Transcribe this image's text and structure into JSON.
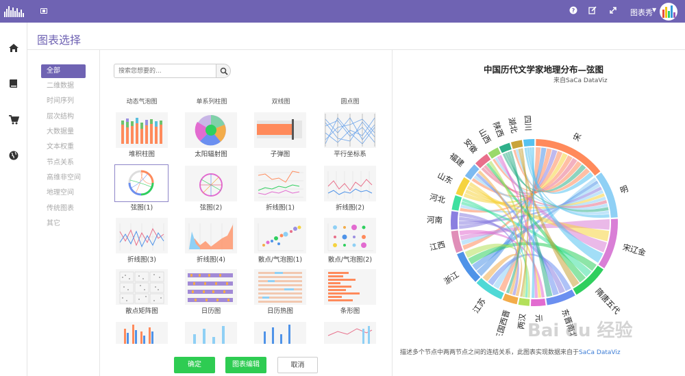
{
  "header": {
    "user_name": "图表秀",
    "icons": [
      "help-icon",
      "edit-icon",
      "fullscreen-icon"
    ]
  },
  "nav_icons": [
    "home-icon",
    "book-icon",
    "cart-icon",
    "globe-icon"
  ],
  "page_title": "图表选择",
  "categories": [
    "全部",
    "二维数据",
    "时间序列",
    "层次结构",
    "大数据量",
    "文本权重",
    "节点关系",
    "高维非空间",
    "地理空间",
    "传统图表",
    "其它"
  ],
  "search": {
    "placeholder": "搜索您想要的..."
  },
  "column_headers": [
    "动态气泡图",
    "单系列柱图",
    "双线图",
    "圆点图"
  ],
  "chart_cards": [
    "堆积柱图",
    "太阳辐射图",
    "子弹图",
    "平行坐标系",
    "弦图(1)",
    "弦图(2)",
    "折线图(1)",
    "折线图(2)",
    "折线图(3)",
    "折线图(4)",
    "散点/气泡图(1)",
    "散点/气泡图(2)",
    "散点矩阵图",
    "日历图",
    "日历热图",
    "条形图"
  ],
  "buttons": {
    "ok": "确定",
    "edit": "图表编辑",
    "cancel": "取消"
  },
  "preview": {
    "title": "中国历代文学家地理分布—弦图",
    "subtitle": "来自SaCa DataViz",
    "description_prefix": "描述多个节点中两两节点之间的连结关系，此图表实现数据来自于",
    "description_link": "SaCa DataViz",
    "watermark": "Bai du 经验"
  },
  "chart_data": {
    "type": "chord",
    "title": "中国历代文学家地理分布—弦图",
    "subtitle": "来自SaCa DataViz",
    "nodes": [
      {
        "name": "宋",
        "color": "#ff8a5b"
      },
      {
        "name": "明",
        "color": "#8fd0f5"
      },
      {
        "name": "宋辽金",
        "color": "#d97fd6"
      },
      {
        "name": "隋唐五代",
        "color": "#2fcf5e"
      },
      {
        "name": "东晋南北朝",
        "color": "#6b8ff0"
      },
      {
        "name": "元",
        "color": "#e26bd0"
      },
      {
        "name": "两汉",
        "color": "#b3e05a"
      },
      {
        "name": "三国西晋",
        "color": "#f3ac4a"
      },
      {
        "name": "江苏",
        "color": "#4fd9d6"
      },
      {
        "name": "浙江",
        "color": "#4f93e8"
      },
      {
        "name": "江西",
        "color": "#e08fb8"
      },
      {
        "name": "河南",
        "color": "#8a7fe0"
      },
      {
        "name": "河北",
        "color": "#3ee0a0"
      },
      {
        "name": "山东",
        "color": "#f5d340"
      },
      {
        "name": "福建",
        "color": "#7cbaf0"
      },
      {
        "name": "安徽",
        "color": "#e86f8a"
      },
      {
        "name": "山西",
        "color": "#9ad96b"
      },
      {
        "name": "陕西",
        "color": "#2fb08a"
      },
      {
        "name": "湖北",
        "color": "#c9a43a"
      },
      {
        "name": "四川",
        "color": "#55c2f0"
      }
    ]
  }
}
